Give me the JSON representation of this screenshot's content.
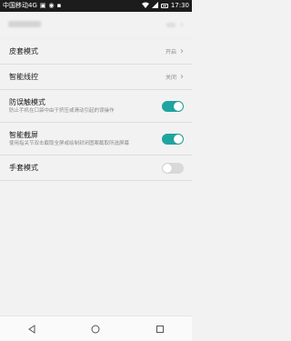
{
  "status_bar": {
    "carrier": "中国移动4G",
    "time": "17:30",
    "icons": [
      "image-icon",
      "wechat-icon",
      "notification-icon",
      "wifi-icon",
      "signal-icon",
      "battery-icon"
    ]
  },
  "settings": {
    "faded_top": {
      "title": ""
    },
    "glove_like_mode": {
      "title": "皮套模式",
      "value": "开启"
    },
    "smart_gesture": {
      "title": "智能线控",
      "value": "关闭"
    },
    "accidental_touch": {
      "title": "防误触模式",
      "subtitle": "防止手机在口袋中由于挤压或滑动引起的误操作",
      "enabled": true
    },
    "smart_screenshot": {
      "title": "智能截屏",
      "subtitle": "使用指关节双击截取全屏或绘制封闭图案截取所选屏幕",
      "enabled": true
    },
    "glove_mode": {
      "title": "手套模式",
      "enabled": false
    }
  },
  "navigation": {
    "back": "back-icon",
    "home": "home-icon",
    "recents": "recents-icon"
  },
  "colors": {
    "accent": "#1fa5a0",
    "status_bar": "#1c1c1c",
    "background": "#f2f2f2"
  }
}
